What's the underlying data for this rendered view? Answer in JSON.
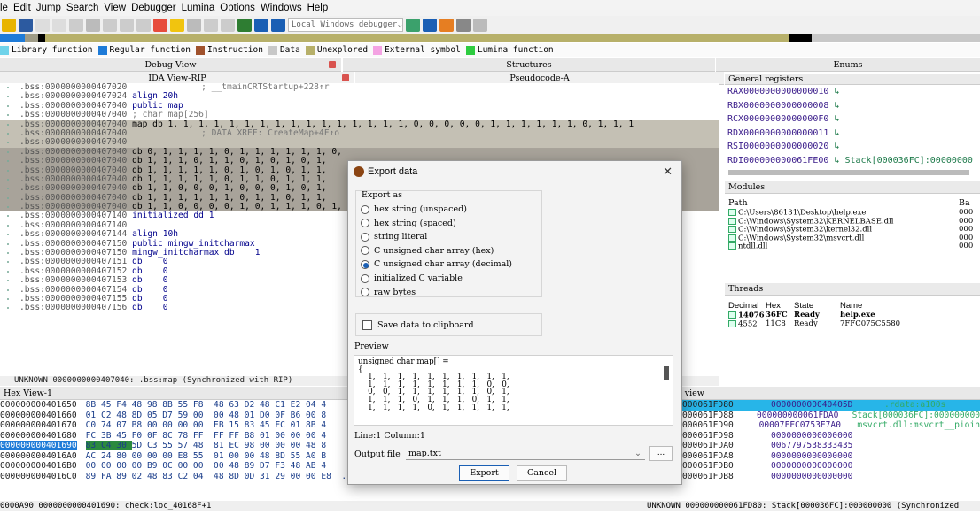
{
  "menu": [
    "le",
    "Edit",
    "Jump",
    "Search",
    "View",
    "Debugger",
    "Lumina",
    "Options",
    "Windows",
    "Help"
  ],
  "toolbar": {
    "debugger": "Local Windows debugger"
  },
  "legend": [
    {
      "label": "Library function",
      "color": "#6fd3ea"
    },
    {
      "label": "Regular function",
      "color": "#1e7bd8"
    },
    {
      "label": "Instruction",
      "color": "#a0522d"
    },
    {
      "label": "Data",
      "color": "#c8c8c8"
    },
    {
      "label": "Unexplored",
      "color": "#b7b06a"
    },
    {
      "label": "External symbol",
      "color": "#f4a3e3"
    },
    {
      "label": "Lumina function",
      "color": "#2ecc40"
    }
  ],
  "panels": {
    "debug_view": "Debug View",
    "ida_view": "IDA View-RIP",
    "structures": "Structures",
    "pseudocode": "Pseudocode-A",
    "enums": "Enums",
    "registers": "General registers",
    "modules": "Modules",
    "threads": "Threads",
    "hex": "Hex View-1",
    "stack": "k view"
  },
  "ida": {
    "lines": [
      {
        "a": ".bss:0000000000407020",
        "t": "",
        "c": "; __tmainCRTStartup+228↑r",
        "k": ""
      },
      {
        "a": ".bss:0000000000407024",
        "t": "align 20h",
        "c": "",
        "k": "kw"
      },
      {
        "a": ".bss:0000000000407040",
        "t": "public map",
        "c": "",
        "k": "kw"
      },
      {
        "a": ".bss:0000000000407040",
        "t": "; char map[256]",
        "c": "",
        "k": "cm"
      },
      {
        "a": ".bss:0000000000407040",
        "t": "map db 1, 1, 1, 1, 1, 1, 1, 1, 1, 1, 1, 1, 1, 1, 1, 1, 0, 0, 0, 0, 0, 1, 1, 1, 1, 1, 1, 0, 1, 1, 1",
        "c": "",
        "k": "hl"
      },
      {
        "a": ".bss:0000000000407040",
        "t": "",
        "c": "; DATA XREF: CreateMap+4F↑o",
        "k": "hl"
      },
      {
        "a": ".bss:0000000000407040",
        "t": "",
        "c": "",
        "k": "hl"
      },
      {
        "a": ".bss:0000000000407040",
        "t": "db 0, 1, 1, 1, 1, 0, 1, 1, 1, 1, 1, 1, 0,",
        "c": "",
        "k": "sel"
      },
      {
        "a": ".bss:0000000000407040",
        "t": "db 1, 1, 1, 0, 1, 1, 0, 1, 0, 1, 0, 1,",
        "c": "",
        "k": "sel"
      },
      {
        "a": ".bss:0000000000407040",
        "t": "db 1, 1, 1, 1, 1, 0, 1, 0, 1, 0, 1, 1,",
        "c": "",
        "k": "sel"
      },
      {
        "a": ".bss:0000000000407040",
        "t": "db 1, 1, 1, 1, 1, 0, 1, 1, 0, 1, 1, 1,",
        "c": "",
        "k": "sel"
      },
      {
        "a": ".bss:0000000000407040",
        "t": "db 1, 1, 0, 0, 0, 1, 0, 0, 0, 1, 0, 1,",
        "c": "",
        "k": "sel"
      },
      {
        "a": ".bss:0000000000407040",
        "t": "db 1, 1, 1, 1, 1, 1, 0, 1, 1, 0, 1, 1,",
        "c": "",
        "k": "sel"
      },
      {
        "a": ".bss:0000000000407040",
        "t": "db 1, 1, 0, 0, 0, 0, 1, 0, 1, 1, 1, 0, 1,",
        "c": "",
        "k": "sel"
      },
      {
        "a": ".bss:0000000000407140",
        "t": "initialized dd 1",
        "c": "",
        "k": "kw"
      },
      {
        "a": ".bss:0000000000407140",
        "t": "",
        "c": "",
        "k": ""
      },
      {
        "a": ".bss:0000000000407144",
        "t": "align 10h",
        "c": "",
        "k": "kw"
      },
      {
        "a": ".bss:0000000000407150",
        "t": "public mingw_initcharmax",
        "c": "",
        "k": "kw"
      },
      {
        "a": ".bss:0000000000407150",
        "t": "mingw_initcharmax db    1",
        "c": "",
        "k": "kw"
      },
      {
        "a": ".bss:0000000000407151",
        "t": "db    0",
        "c": "",
        "k": "kw"
      },
      {
        "a": ".bss:0000000000407152",
        "t": "db    0",
        "c": "",
        "k": "kw"
      },
      {
        "a": ".bss:0000000000407153",
        "t": "db    0",
        "c": "",
        "k": "kw"
      },
      {
        "a": ".bss:0000000000407154",
        "t": "db    0",
        "c": "",
        "k": "kw"
      },
      {
        "a": ".bss:0000000000407155",
        "t": "db    0",
        "c": "",
        "k": "kw"
      },
      {
        "a": ".bss:0000000000407156",
        "t": "db    0",
        "c": "",
        "k": "kw"
      }
    ],
    "status": "UNKNOWN 0000000000407040: .bss:map (Synchronized with RIP)"
  },
  "registers": [
    {
      "n": "RAX",
      "v": "0000000000000010",
      "x": ""
    },
    {
      "n": "RBX",
      "v": "0000000000000008",
      "x": ""
    },
    {
      "n": "RCX",
      "v": "00000000000000F0",
      "x": ""
    },
    {
      "n": "RDX",
      "v": "0000000000000011",
      "x": ""
    },
    {
      "n": "RSI",
      "v": "0000000000000020",
      "x": ""
    },
    {
      "n": "RDI",
      "v": "000000000061FE00",
      "x": "Stack[000036FC]:00000000"
    }
  ],
  "modules": {
    "header": "Path",
    "header2": "Ba",
    "rows": [
      {
        "p": "C:\\Users\\86131\\Desktop\\help.exe",
        "b": "000"
      },
      {
        "p": "C:\\Windows\\System32\\KERNELBASE.dll",
        "b": "000"
      },
      {
        "p": "C:\\Windows\\System32\\kernel32.dll",
        "b": "000"
      },
      {
        "p": "C:\\Windows\\System32\\msvcrt.dll",
        "b": "000"
      },
      {
        "p": "ntdll.dll",
        "b": "000"
      }
    ]
  },
  "threads": {
    "cols": [
      "Decimal",
      "Hex",
      "State",
      "Name"
    ],
    "rows": [
      {
        "d": "14076",
        "h": "36FC",
        "s": "Ready",
        "n": "help.exe"
      },
      {
        "d": "4552",
        "h": "11C8",
        "s": "Ready",
        "n": "7FFC075C5580"
      }
    ]
  },
  "hex": {
    "rows": [
      {
        "a": "000000000401650",
        "b": "8B 45 F4 48 98 8B 55 F8  48 63 D2 48 C1 E2 04 4"
      },
      {
        "a": "000000000401660",
        "b": "01 C2 48 8D 05 D7 59 00  00 48 01 D0 0F B6 00 8"
      },
      {
        "a": "000000000401670",
        "b": "C0 74 07 B8 00 00 00 00  EB 15 83 45 FC 01 8B 4"
      },
      {
        "a": "000000000401680",
        "b": "FC 3B 45 F0 0F 8C 78 FF  FF FF B8 01 00 00 00 4"
      },
      {
        "a": "000000000401690",
        "b": "83 C4 30 5D C3 55 57 48  81 EC 98 00 00 00 48 8"
      },
      {
        "a": "0000000004016A0",
        "b": "AC 24 80 00 00 00 E8 55  01 00 00 48 8D 55 A0 B"
      },
      {
        "a": "0000000004016B0",
        "b": "00 00 00 00 B9 0C 00 00  00 48 89 D7 F3 48 AB 4"
      },
      {
        "a": "0000000004016C0",
        "b": "89 FA 89 02 48 83 C2 04  48 8D 0D 31 29 00 00 E8  ....H...H..1)..."
      }
    ],
    "status": "0000A90 0000000000401690: check:loc_40168F+1"
  },
  "stack": {
    "rows": [
      {
        "a": "000061FD80",
        "v": "000000000040405D",
        "c": ".rdata:a100s"
      },
      {
        "a": "000061FD88",
        "v": "000000000061FDA0",
        "c": "Stack[000036FC]:000000000"
      },
      {
        "a": "000061FD90",
        "v": "00007FFC0753E7A0",
        "c": "msvcrt.dll:msvcrt__pioin"
      },
      {
        "a": "000061FD98",
        "v": "0000000000000000",
        "c": ""
      },
      {
        "a": "000061FDA0",
        "v": "0067797538333435",
        "c": ""
      },
      {
        "a": "000061FDA8",
        "v": "0000000000000000",
        "c": ""
      },
      {
        "a": "000061FDB0",
        "v": "0000000000000000",
        "c": ""
      },
      {
        "a": "000061FDB8",
        "v": "0000000000000000",
        "c": ""
      }
    ],
    "status": "UNKNOWN 000000000061FD80: Stack[000036FC]:000000000 (Synchronized"
  },
  "dialog": {
    "title": "Export data",
    "export_as": "Export as",
    "options": [
      "hex string (unspaced)",
      "hex string (spaced)",
      "string literal",
      "C unsigned char array (hex)",
      "C unsigned char array (decimal)",
      "initialized C variable",
      "raw bytes"
    ],
    "selected": 4,
    "clipboard": "Save data to clipboard",
    "preview_label": "Preview",
    "preview": [
      "unsigned char map[] =",
      "{",
      "    1,   1,   1,   1,   1,   1,   1,   1,   1,   1,",
      "    1,   1,   1,   1,   1,   1,   1,   1,   0,   0,",
      "    0,   0,   1,   1,   1,   1,   1,   1,   0,   1,",
      "    1,   1,   1,   0,   1,   1,   1,   0,   1,   1,",
      "    1,   1,   1,   1,   0,   1,   1,   1,   1,   1,"
    ],
    "linecol": "Line:1  Column:1",
    "output_label": "Output file",
    "output_value": "map.txt",
    "browse": "...",
    "export_btn": "Export",
    "cancel_btn": "Cancel"
  }
}
